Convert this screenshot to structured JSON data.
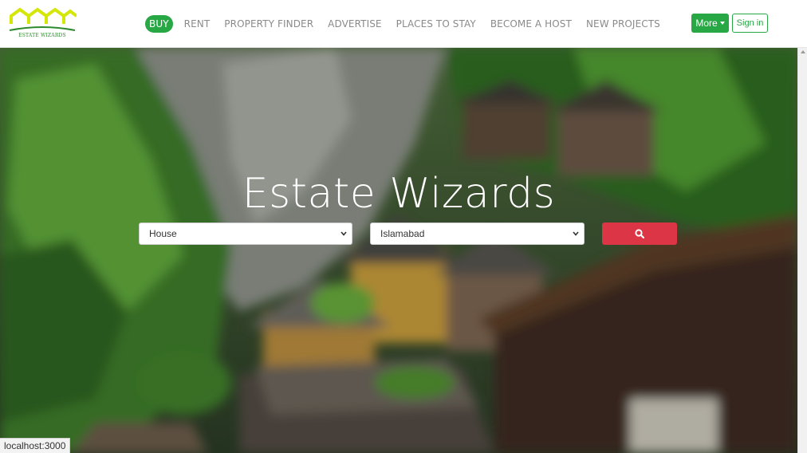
{
  "brand": {
    "logo_text": "ESTATE WIZARDS",
    "logo_color": "#d4e60a",
    "accent_color": "#28a745"
  },
  "nav": {
    "items": [
      {
        "label": "BUY",
        "active": true
      },
      {
        "label": "RENT",
        "active": false
      },
      {
        "label": "PROPERTY FINDER",
        "active": false
      },
      {
        "label": "ADVERTISE",
        "active": false
      },
      {
        "label": "PLACES TO STAY",
        "active": false
      },
      {
        "label": "BECOME A HOST",
        "active": false
      },
      {
        "label": "NEW PROJECTS",
        "active": false
      }
    ],
    "more_label": "More",
    "signin_label": "Sign in"
  },
  "hero": {
    "title": "Estate Wizards",
    "property_type_selected": "House",
    "city_selected": "Islamabad",
    "search_button_color": "#dc3545",
    "search_icon": "search-icon"
  },
  "status": {
    "url": "localhost:3000"
  }
}
